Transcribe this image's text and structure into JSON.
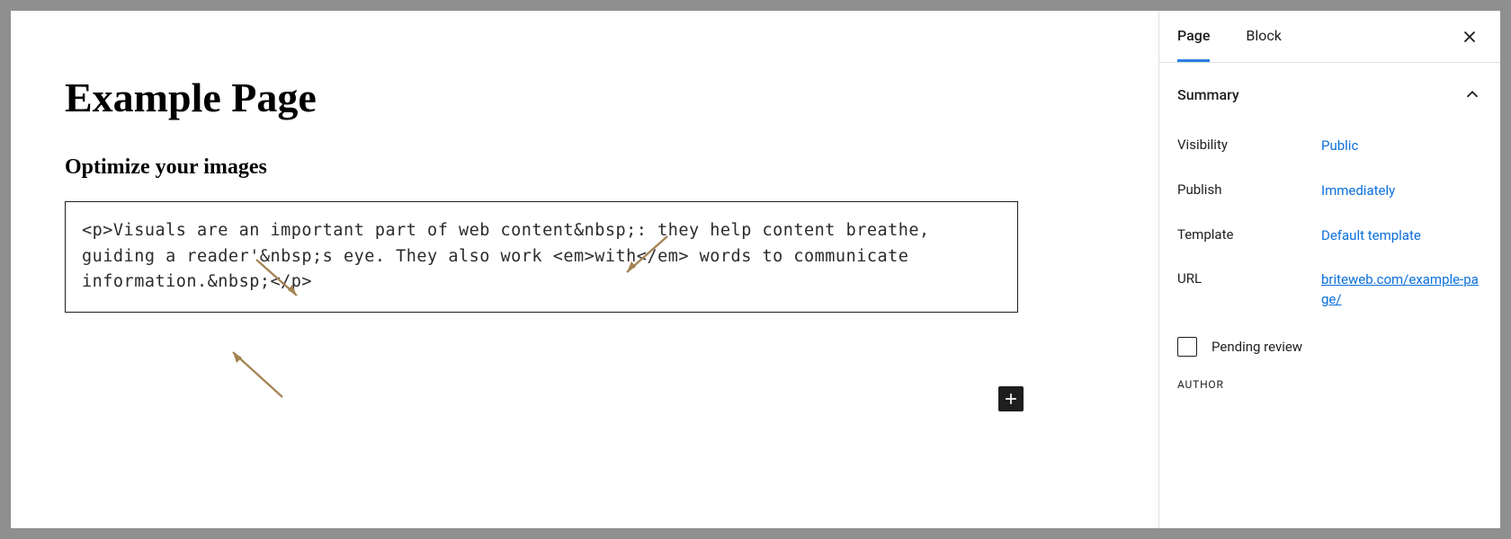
{
  "editor": {
    "page_title": "Example Page",
    "sub_heading": "Optimize your images",
    "code_block": "<p>Visuals are an important part of web content&nbsp;: they help content breathe, guiding a reader'&nbsp;s eye. They also work <em>with</em> words to communicate information.&nbsp;</p>"
  },
  "sidebar": {
    "tabs": {
      "page": "Page",
      "block": "Block",
      "active": "page"
    },
    "summary": {
      "heading": "Summary",
      "rows": {
        "visibility": {
          "label": "Visibility",
          "value": "Public"
        },
        "publish": {
          "label": "Publish",
          "value": "Immediately"
        },
        "template": {
          "label": "Template",
          "value": "Default template"
        },
        "url": {
          "label": "URL",
          "value": "briteweb.com/example-page/"
        }
      },
      "pending_review": "Pending review",
      "author_heading": "AUTHOR"
    }
  },
  "colors": {
    "link": "#0a6fdb",
    "accent_tab": "#2b80e0",
    "arrow": "#a38253"
  }
}
